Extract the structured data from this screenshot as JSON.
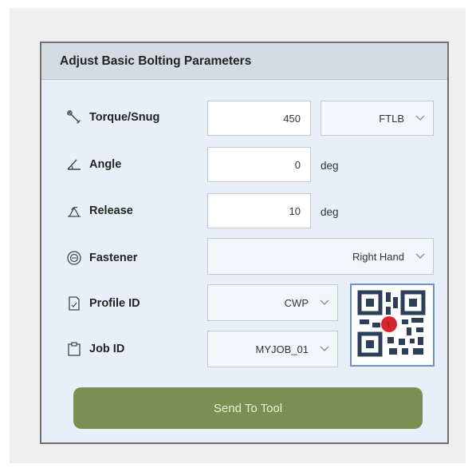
{
  "panel": {
    "title": "Adjust Basic Bolting Parameters"
  },
  "rows": {
    "torque": {
      "label": "Torque/Snug",
      "icon": "wrench-icon",
      "value": "450",
      "unit_selected": "FTLB"
    },
    "angle": {
      "label": "Angle",
      "icon": "angle-icon",
      "value": "0",
      "unit": "deg"
    },
    "release": {
      "label": "Release",
      "icon": "release-arrow-icon",
      "value": "10",
      "unit": "deg"
    },
    "fastener": {
      "label": "Fastener",
      "icon": "fastener-icon",
      "selected": "Right Hand"
    },
    "profile": {
      "label": "Profile ID",
      "icon": "document-icon",
      "selected": "CWP"
    },
    "job": {
      "label": "Job ID",
      "icon": "clipboard-icon",
      "selected": "MYJOB_01"
    }
  },
  "qr": {
    "icon": "qr-code-scan-icon"
  },
  "send_button": {
    "label": "Send To Tool",
    "color": "#7b8f53"
  }
}
